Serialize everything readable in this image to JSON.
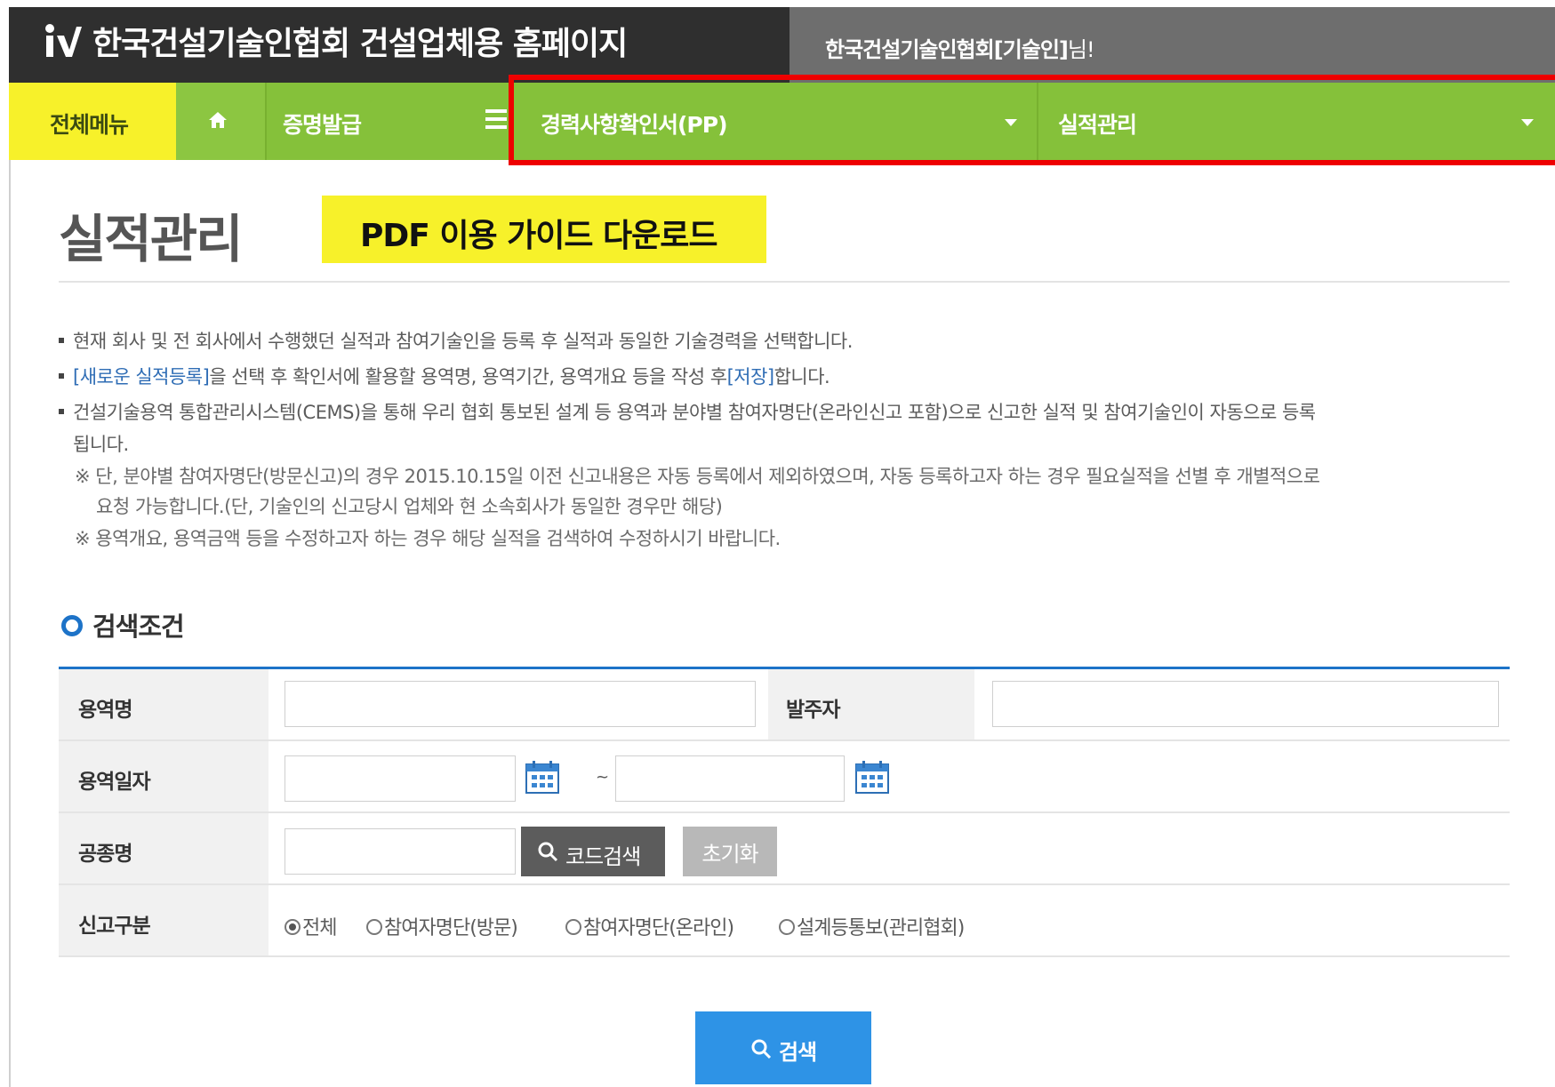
{
  "header": {
    "site_title": "한국건설기술인협회 건설업체용 홈페이지",
    "user_name": "한국건설기술인협회[기술인]",
    "user_suffix": "님!"
  },
  "nav": {
    "all_menu": "전체메뉴",
    "home_icon": "home-icon",
    "item1": "증명발급",
    "menu_icon": "hamburger-icon",
    "item2": "경력사항확인서(PP)",
    "item3": "실적관리"
  },
  "colors": {
    "nav_green": "#85c13a",
    "highlight_yellow": "#f7f12a",
    "accent_blue": "#1d73c8",
    "search_button": "#2e93e6",
    "annotation_red": "#ee0000"
  },
  "page": {
    "title": "실적관리",
    "pdf_banner": "PDF 이용 가이드 다운로드"
  },
  "info": {
    "line1": "현재 회사 및 전 회사에서 수행했던 실적과 참여기술인을 등록 후 실적과 동일한 기술경력을 선택합니다.",
    "line2_link1": "[새로운 실적등록]",
    "line2_mid": "을 선택 후 확인서에 활용할 용역명, 용역기간, 용역개요 등을 작성 후",
    "line2_link2": "[저장]",
    "line2_end": "합니다.",
    "line3a": "건설기술용역 통합관리시스템(CEMS)을 통해 우리 협회 통보된 설계 등 용역과 분야별 참여자명단(온라인신고 포함)으로 신고한 실적 및 참여기술인이 자동으로 등록",
    "line3b": "됩니다.",
    "note1a": "※ 단, 분야별 참여자명단(방문신고)의 경우 2015.10.15일 이전 신고내용은 자동 등록에서 제외하였으며, 자동 등록하고자 하는 경우 필요실적을 선별 후 개별적으로",
    "note1b": "요청 가능합니다.(단, 기술인의 신고당시 업체와 현 소속회사가 동일한 경우만 해당)",
    "note2": "※ 용역개요, 용역금액 등을 수정하고자 하는 경우 해당 실적을 검색하여 수정하시기 바랍니다."
  },
  "search": {
    "section_title": "검색조건",
    "service_name_label": "용역명",
    "service_name_value": "",
    "client_label": "발주자",
    "client_value": "",
    "date_label": "용역일자",
    "date_from": "",
    "date_to": "",
    "date_separator": "~",
    "calendar_icon": "calendar-icon",
    "work_type_label": "공종명",
    "work_type_value": "",
    "code_search_button": "코드검색",
    "reset_button": "초기화",
    "report_type_label": "신고구분",
    "report_options": [
      "전체",
      "참여자명단(방문)",
      "참여자명단(온라인)",
      "설계등통보(관리협회)"
    ],
    "report_selected": "전체",
    "search_button": "검색"
  }
}
